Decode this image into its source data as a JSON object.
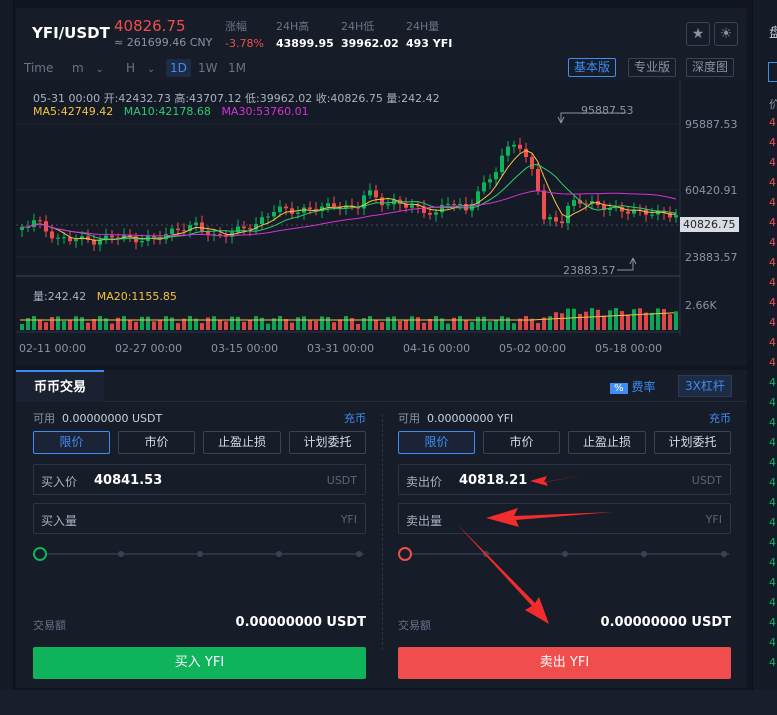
{
  "ticker": {
    "pair": "YFI/USDT",
    "price": "40826.75",
    "price_cny": "≈ 261699.46 CNY",
    "change_label": "涨幅",
    "change_value": "-3.78%",
    "high_label": "24H高",
    "high_value": "43899.95",
    "low_label": "24H低",
    "low_value": "39962.02",
    "vol_label": "24H量",
    "vol_value": "493 YFI",
    "star_icon": "star-icon",
    "theme_icon": "sun-icon"
  },
  "toolbar": {
    "time": "Time",
    "minute": "m",
    "hour": "H",
    "day": "1D",
    "week": "1W",
    "month": "1M",
    "basic": "基本版",
    "pro": "专业版",
    "depth": "深度图"
  },
  "chart": {
    "ohlc_text": "05-31 00:00   开:42432.73  高:43707.12  低:39962.02  收:40826.75  量:242.42",
    "ma5": "MA5:42749.42",
    "ma10": "MA10:42178.68",
    "ma30": "MA30:53760.01",
    "vol": "量:242.42",
    "ma20": "MA20:1155.85",
    "y_ticks": [
      "95887.53",
      "60420.91",
      "23883.57"
    ],
    "last_price": "40826.75",
    "vol_tick": "2.66K",
    "max_annot": "95887.53",
    "min_annot": "23883.57",
    "x_ticks": [
      "02-11 00:00",
      "02-27 00:00",
      "03-15 00:00",
      "03-31 00:00",
      "04-16 00:00",
      "05-02 00:00",
      "05-18 00:00"
    ],
    "colors": {
      "up": "#0eb35b",
      "down": "#f04d4d",
      "ma5": "#f5c342",
      "ma10": "#2ecc71",
      "ma30": "#d630d6"
    }
  },
  "trade": {
    "tab": "币币交易",
    "fee_pct": "%",
    "fee_label": "费率",
    "leverage": "3X杠杆",
    "buy": {
      "avail_label": "可用",
      "avail_value": "0.00000000 USDT",
      "charge": "充币",
      "types": [
        "限价",
        "市价",
        "止盈止损",
        "计划委托"
      ],
      "price_label": "买入价",
      "price_value": "40841.53",
      "price_unit": "USDT",
      "qty_label": "买入量",
      "qty_unit": "YFI",
      "amount_label": "交易额",
      "amount_value": "0.00000000 USDT",
      "button": "买入 YFI"
    },
    "sell": {
      "avail_label": "可用",
      "avail_value": "0.00000000 YFI",
      "charge": "充币",
      "types": [
        "限价",
        "市价",
        "止盈止损",
        "计划委托"
      ],
      "price_label": "卖出价",
      "price_value": "40818.21",
      "price_unit": "USDT",
      "qty_label": "卖出量",
      "qty_unit": "YFI",
      "amount_label": "交易额",
      "amount_value": "0.00000000 USDT",
      "button": "卖出 YFI"
    }
  },
  "right_panel": {
    "head": "盘",
    "items": [
      "价",
      "4",
      "4",
      "4",
      "4",
      "4",
      "4",
      "4",
      "4",
      "4",
      "4",
      "4",
      "4",
      "4",
      "4",
      "4",
      "4",
      "4",
      "4",
      "4",
      "4",
      "4",
      "4",
      "4",
      "4",
      "4",
      "4",
      "4",
      "4"
    ]
  }
}
